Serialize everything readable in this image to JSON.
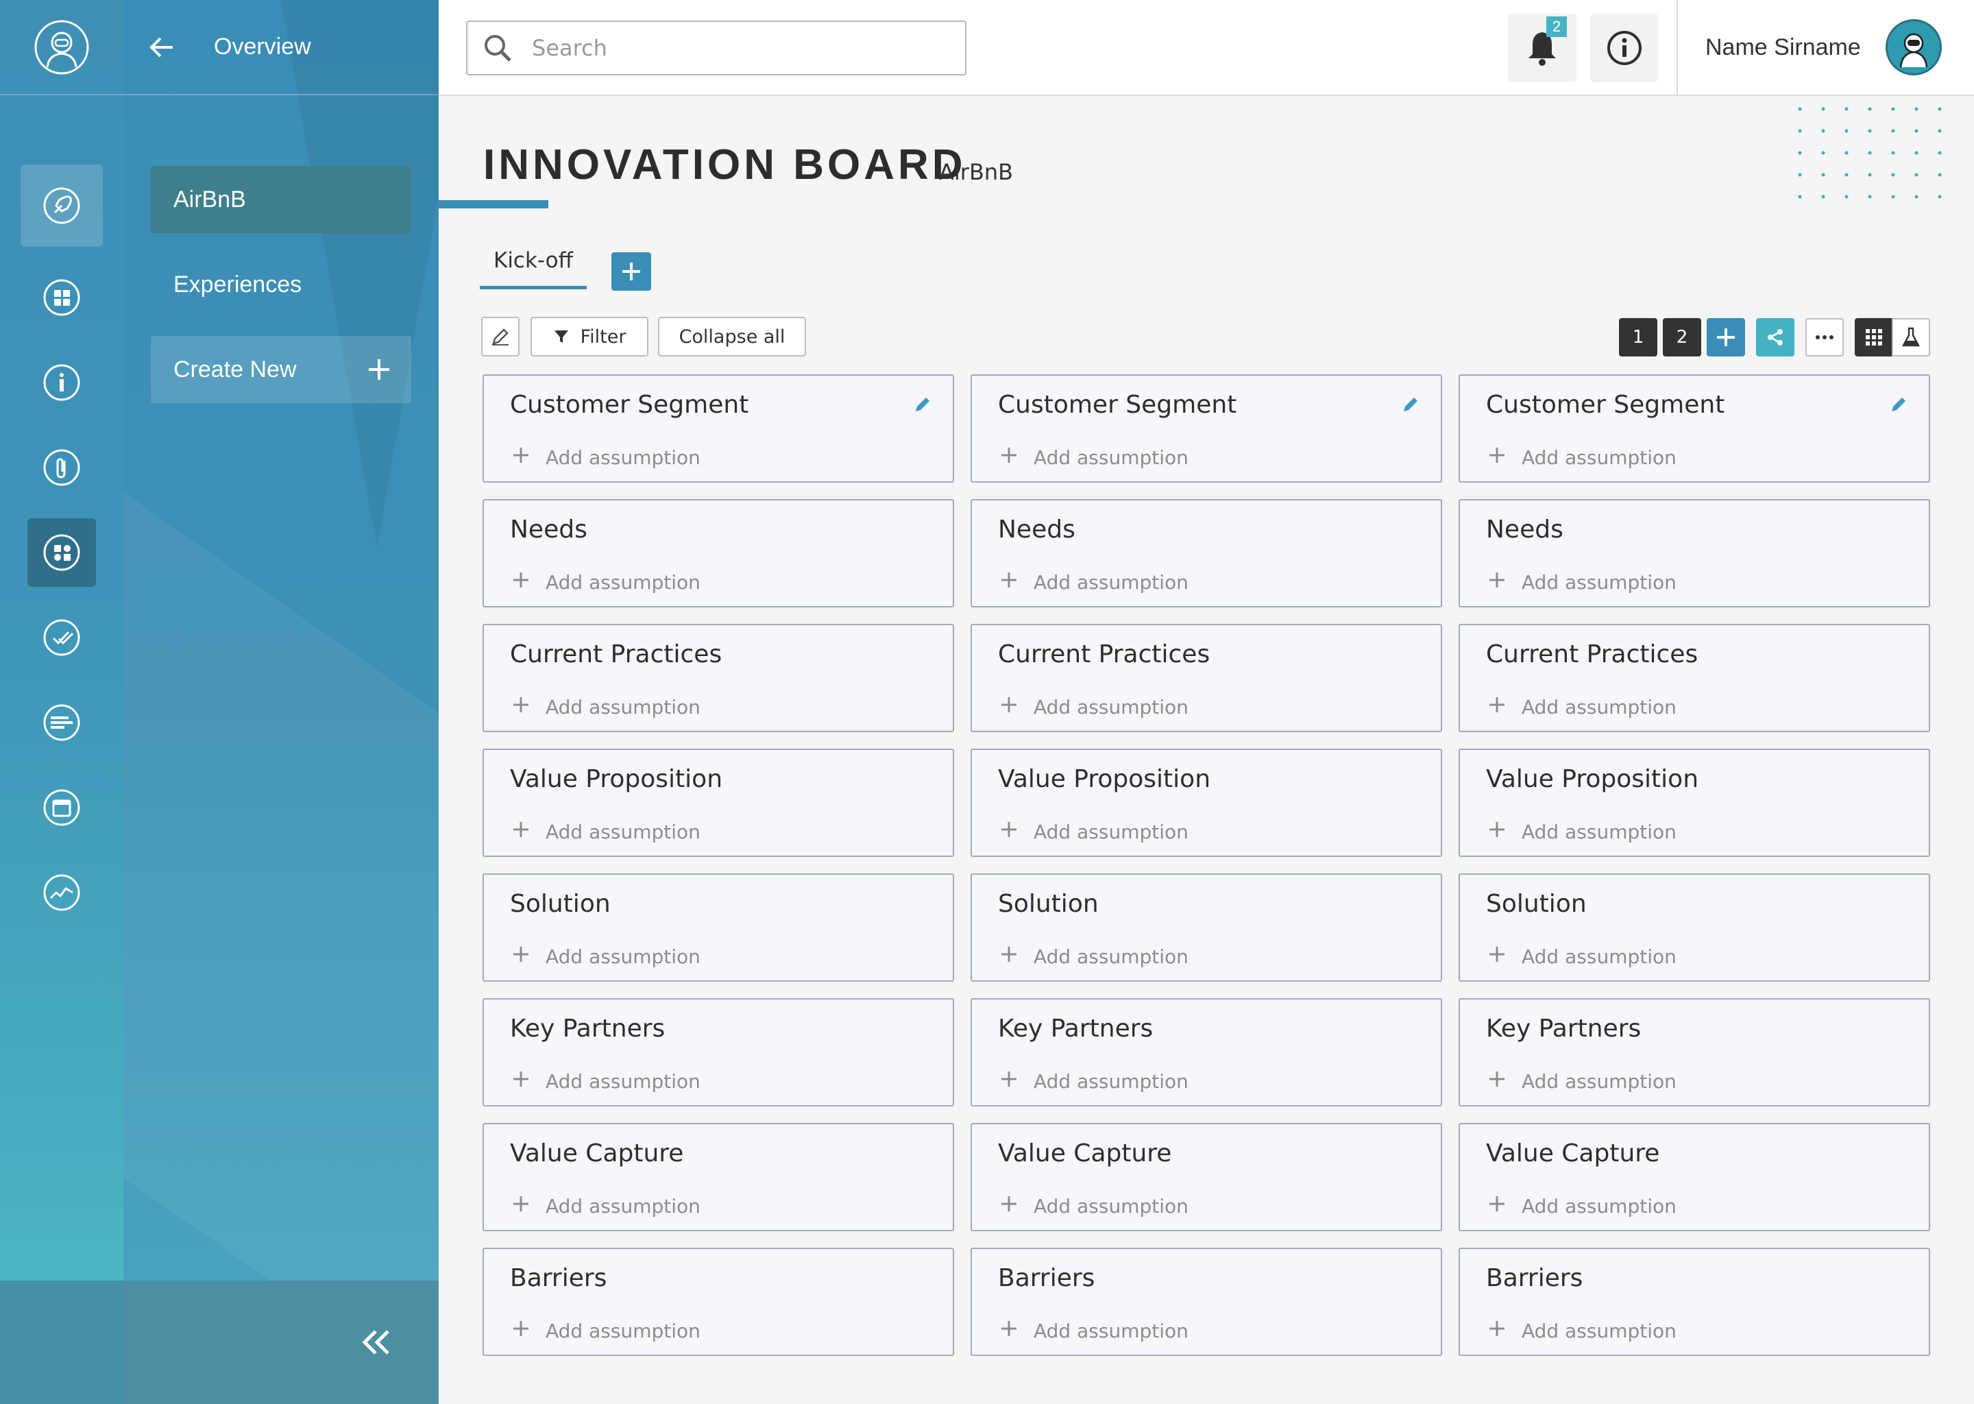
{
  "nav": {
    "back_label": "Overview",
    "items": [
      {
        "label": "AirBnB"
      },
      {
        "label": "Experiences"
      }
    ],
    "create_label": "Create New"
  },
  "topbar": {
    "search_placeholder": "Search",
    "notification_count": "2",
    "user_name": "Name Sirname"
  },
  "board": {
    "title": "INNOVATION BOARD",
    "subtitle": "AirBnB",
    "tabs": [
      {
        "label": "Kick-off"
      }
    ]
  },
  "toolbar": {
    "filter_label": "Filter",
    "collapse_label": "Collapse all",
    "page_1": "1",
    "page_2": "2"
  },
  "columns": [
    {
      "cards": [
        "Customer Segment",
        "Needs",
        "Current Practices",
        "Value Proposition",
        "Solution",
        "Key Partners",
        "Value Capture",
        "Barriers"
      ]
    },
    {
      "cards": [
        "Customer Segment",
        "Needs",
        "Current Practices",
        "Value Proposition",
        "Solution",
        "Key Partners",
        "Value Capture",
        "Barriers"
      ]
    },
    {
      "cards": [
        "Customer Segment",
        "Needs",
        "Current Practices",
        "Value Proposition",
        "Solution",
        "Key Partners",
        "Value Capture",
        "Barriers"
      ]
    }
  ],
  "add_assumption_label": "Add assumption",
  "colors": {
    "accent": "#3a8db6",
    "teal": "#45b3c3",
    "dark": "#333333"
  }
}
